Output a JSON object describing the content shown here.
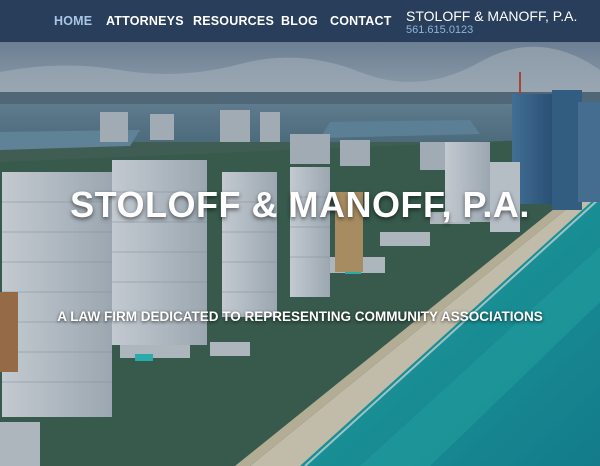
{
  "nav": {
    "items": [
      {
        "label": "HOME",
        "active": true
      },
      {
        "label": "ATTORNEYS",
        "active": false
      },
      {
        "label": "RESOURCES",
        "active": false
      },
      {
        "label": "BLOG",
        "active": false
      },
      {
        "label": "CONTACT",
        "active": false
      }
    ],
    "brand": "STOLOFF & MANOFF, P.A.",
    "phone": "561.615.0123"
  },
  "hero": {
    "title": "STOLOFF & MANOFF, P.A.",
    "subtitle": "A LAW FIRM DEDICATED TO REPRESENTING COMMUNITY ASSOCIATIONS"
  },
  "colors": {
    "nav_background": "#283e5a",
    "nav_active": "#a9c6e6",
    "phone": "#8fb4db",
    "ocean": "#1fb5b0"
  }
}
